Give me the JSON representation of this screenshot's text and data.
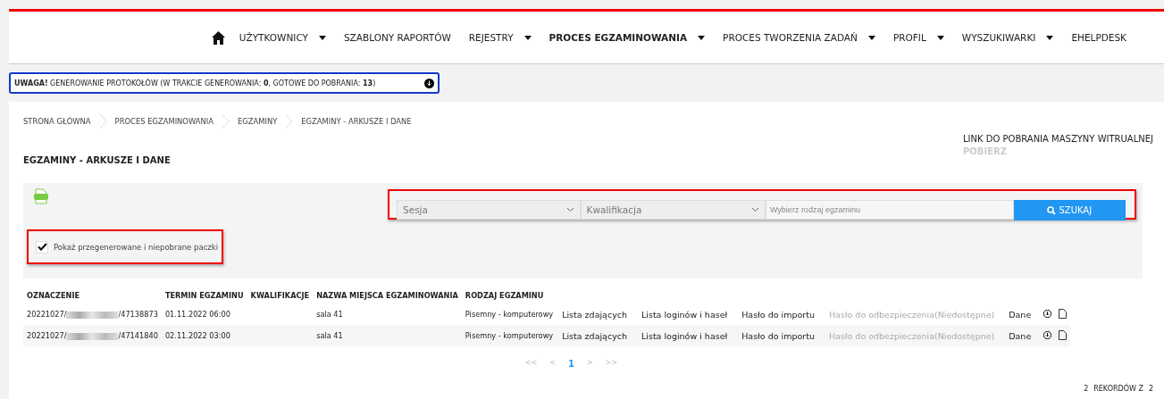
{
  "nav": {
    "items": [
      {
        "label": "UŻYTKOWNICY",
        "selected": false,
        "dropdown": true
      },
      {
        "label": "SZABLONY RAPORTÓW",
        "selected": false,
        "dropdown": false
      },
      {
        "label": "REJESTRY",
        "selected": false,
        "dropdown": true
      },
      {
        "label": "PROCES EGZAMINOWANIA",
        "selected": true,
        "dropdown": true
      },
      {
        "label": "PROCES TWORZENIA ZADAŃ",
        "selected": false,
        "dropdown": true
      },
      {
        "label": "PROFIL",
        "selected": false,
        "dropdown": true
      },
      {
        "label": "WYSZUKIWARKI",
        "selected": false,
        "dropdown": true
      },
      {
        "label": "EHELPDESK",
        "selected": false,
        "dropdown": false
      }
    ]
  },
  "notice": {
    "text": "**UWAGA!** GENEROWANIE PROTOKOŁÓW (W TRAKCIE GENEROWANIA: **0**, GOTOWE DO POBRANIA: **13**)"
  },
  "breadcrumbs": [
    "STRONA GŁÓWNA",
    "PROCES EGZAMINOWANIA",
    "EGZAMINY",
    "EGZAMINY - ARKUSZE I DANE"
  ],
  "page_title": "EGZAMINY - ARKUSZE I DANE",
  "vm_link": {
    "label": "LINK DO POBRANIA MASZYNY WITRUALNEJ",
    "action": "POBIERZ"
  },
  "filters": {
    "session": {
      "placeholder": "Sesja"
    },
    "qualification": {
      "placeholder": "Kwalifikacja"
    },
    "exam_type": {
      "placeholder": "Wybierz rodzaj egzaminu"
    },
    "search_button": "SZUKAJ"
  },
  "show_regenerated": {
    "label": "Pokaż przegenerowane i niepobrane paczki",
    "checked": true
  },
  "table": {
    "columns": [
      "OZNACZENIE",
      "TERMIN EGZAMINU",
      "KWALIFIKACJE",
      "NAZWA MIEJSCA EGZAMINOWANIA",
      "RODZAJ EGZAMINU"
    ],
    "rows": [
      {
        "id_prefix": "20221027/",
        "id_suffix": "/47138873",
        "date": "01.11.2022 06:00",
        "qualifications": "",
        "place": "sala 41",
        "type": "Pisemny - komputerowy",
        "actions": [
          {
            "label": "Lista zdających",
            "disabled": false
          },
          {
            "label": "Lista loginów i haseł",
            "disabled": false
          },
          {
            "label": "Hasło do importu",
            "disabled": false
          },
          {
            "label": "Hasło do odbezpieczenia(Niedostępne)",
            "disabled": true
          },
          {
            "label": "Dane",
            "disabled": false
          }
        ]
      },
      {
        "id_prefix": "20221027/",
        "id_suffix": "/47141840",
        "date": "02.11.2022 03:00",
        "qualifications": "",
        "place": "sala 41",
        "type": "Pisemny - komputerowy",
        "actions": [
          {
            "label": "Lista zdających",
            "disabled": false
          },
          {
            "label": "Lista loginów i haseł",
            "disabled": false
          },
          {
            "label": "Hasło do importu",
            "disabled": false
          },
          {
            "label": "Hasło do odbezpieczenia(Niedostępne)",
            "disabled": true
          },
          {
            "label": "Dane",
            "disabled": false
          }
        ]
      }
    ]
  },
  "pagination": [
    {
      "label": "<<",
      "selected": false
    },
    {
      "label": "<",
      "selected": false
    },
    {
      "label": "1",
      "selected": true
    },
    {
      "label": ">",
      "selected": false
    },
    {
      "label": ">>",
      "selected": false
    }
  ],
  "records": {
    "count": "2",
    "label": "REKORDÓW Z",
    "total": "2"
  }
}
